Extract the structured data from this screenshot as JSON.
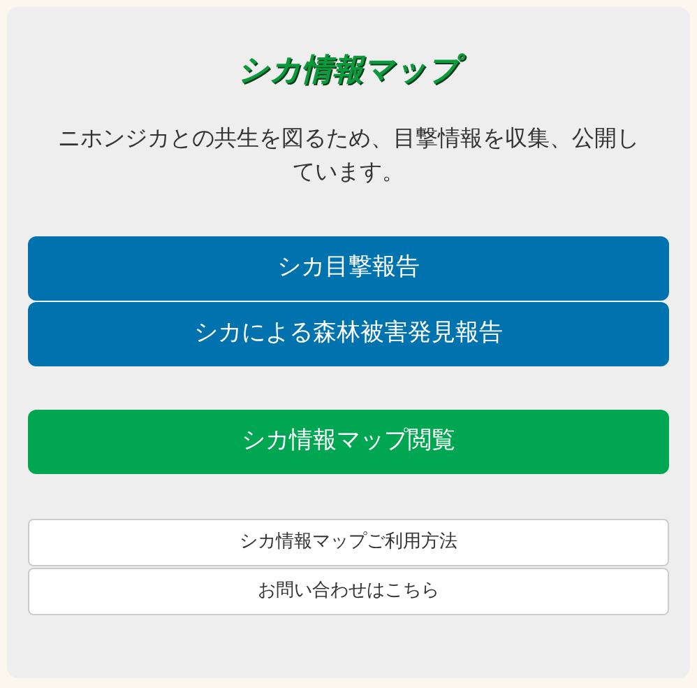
{
  "title": "シカ情報マップ",
  "description": "ニホンジカとの共生を図るため、目撃情報を収集、公開しています。",
  "button_groups": [
    {
      "buttons": [
        {
          "label": "シカ目撃報告",
          "kind": "primary"
        },
        {
          "label": "シカによる森林被害発見報告",
          "kind": "primary"
        }
      ]
    },
    {
      "buttons": [
        {
          "label": "シカ情報マップ閲覧",
          "kind": "success"
        }
      ]
    },
    {
      "buttons": [
        {
          "label": "シカ情報マップご利用方法",
          "kind": "plain"
        },
        {
          "label": "お問い合わせはこちら",
          "kind": "plain"
        }
      ]
    }
  ]
}
